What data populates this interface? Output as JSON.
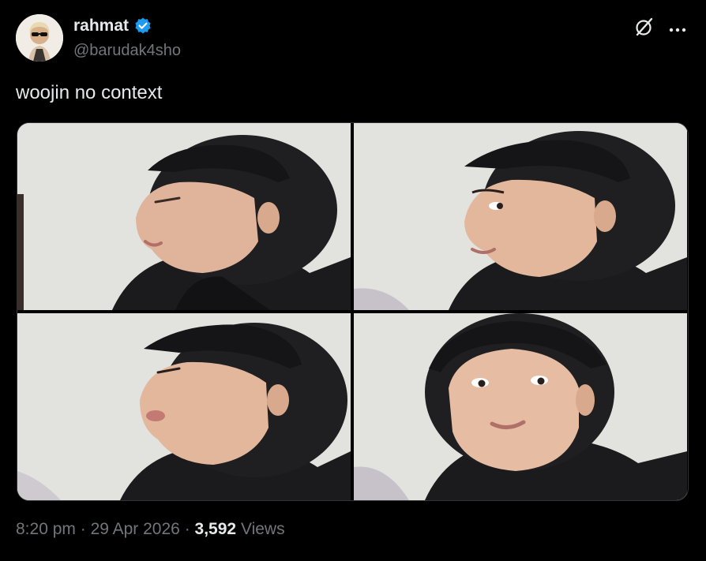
{
  "tweet": {
    "author": {
      "display_name": "rahmat",
      "handle": "@barudak4sho",
      "verified": true,
      "avatar_icon": "avatar-image",
      "verified_icon": "verified-badge-icon"
    },
    "header_icons": [
      "grok-icon",
      "more-options-icon"
    ],
    "text": "woojin no context",
    "media": {
      "count": 4,
      "items": [
        {
          "icon": "photo-image"
        },
        {
          "icon": "photo-image"
        },
        {
          "icon": "photo-image"
        },
        {
          "icon": "photo-image"
        }
      ]
    },
    "meta": {
      "time": "8:20 pm",
      "separator": "·",
      "date": "29 Apr 2026",
      "views_count": "3,592",
      "views_label": "Views"
    }
  },
  "colors": {
    "background": "#000000",
    "text_primary": "#e7e9ea",
    "text_secondary": "#71767b",
    "verified_blue": "#1d9bf0",
    "border": "#2f3336"
  }
}
